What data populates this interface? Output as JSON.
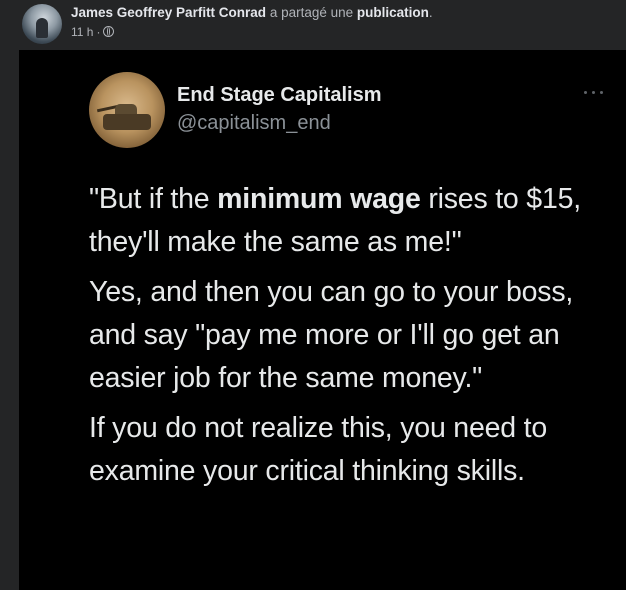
{
  "share": {
    "author": "James Geoffrey Parfitt Conrad",
    "action": " a partagé une ",
    "object": "publication",
    "end": ".",
    "time": "11 h",
    "separator": "·",
    "audience_icon": "globe-icon"
  },
  "tweet": {
    "name": "End Stage Capitalism",
    "handle": "@capitalism_end",
    "more_icon": "more-options-icon",
    "paragraph1": {
      "before": "\"But if the ",
      "bold": "minimum wage",
      "after": " rises to $15, they'll make the same as me!\""
    },
    "paragraph2": "Yes, and then you can go to your boss, and say \"pay me more or I'll go get an easier job for the same money.\"",
    "paragraph3": "If you do not realize this, you need to examine your critical thinking skills."
  },
  "colors": {
    "page_bg": "#242526",
    "tweet_bg": "#000000",
    "primary_text": "#e4e6eb",
    "secondary_text": "#b0b3b8",
    "tweet_text": "#e7e9ea",
    "handle_text": "#8b9197"
  }
}
